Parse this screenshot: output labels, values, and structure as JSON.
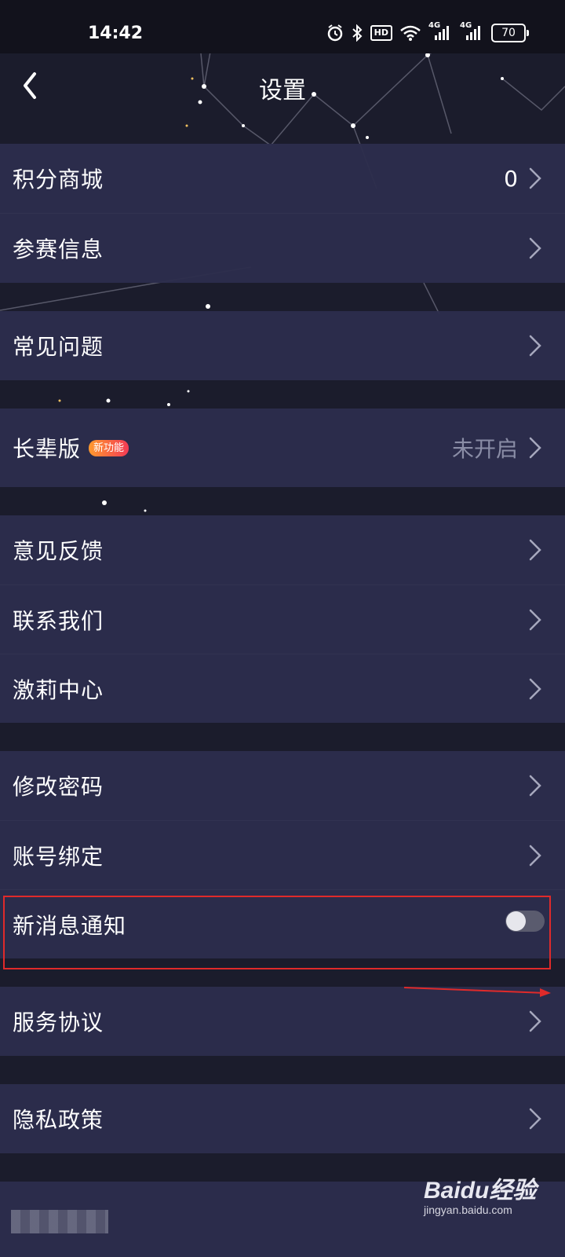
{
  "status_bar": {
    "time": "14:42",
    "hd_label": "HD",
    "network_1": "4G",
    "network_2": "4G",
    "battery": "70",
    "icons": [
      "alarm-icon",
      "bluetooth-icon",
      "wifi-icon",
      "signal-icon",
      "signal-icon",
      "battery-icon"
    ]
  },
  "header": {
    "title": "设置",
    "back_icon": "chevron-left-icon"
  },
  "groups": [
    {
      "items": [
        {
          "label": "积分商城",
          "value": "0"
        },
        {
          "label": "参赛信息",
          "value": ""
        }
      ]
    },
    {
      "items": [
        {
          "label": "常见问题",
          "value": ""
        }
      ]
    },
    {
      "items": [
        {
          "label": "长辈版",
          "badge": "新功能",
          "value": "未开启"
        }
      ]
    },
    {
      "items": [
        {
          "label": "意见反馈",
          "value": ""
        },
        {
          "label": "联系我们",
          "value": ""
        },
        {
          "label": "激莉中心",
          "value": ""
        }
      ]
    },
    {
      "items": [
        {
          "label": "修改密码",
          "value": ""
        },
        {
          "label": "账号绑定",
          "value": ""
        },
        {
          "label": "新消息通知",
          "toggle": false
        }
      ]
    },
    {
      "items": [
        {
          "label": "服务协议",
          "value": ""
        }
      ]
    },
    {
      "items": [
        {
          "label": "隐私政策",
          "value": ""
        }
      ]
    }
  ],
  "annotation": {
    "highlight_color": "#e02a2a"
  },
  "watermark": {
    "brand": "Baidu经验",
    "url": "jingyan.baidu.com"
  },
  "colors": {
    "background": "#1b1c2c",
    "row_background": "#2c2d4c",
    "muted_text": "#8a8da6",
    "toggle_off": "#5a5b6e"
  }
}
